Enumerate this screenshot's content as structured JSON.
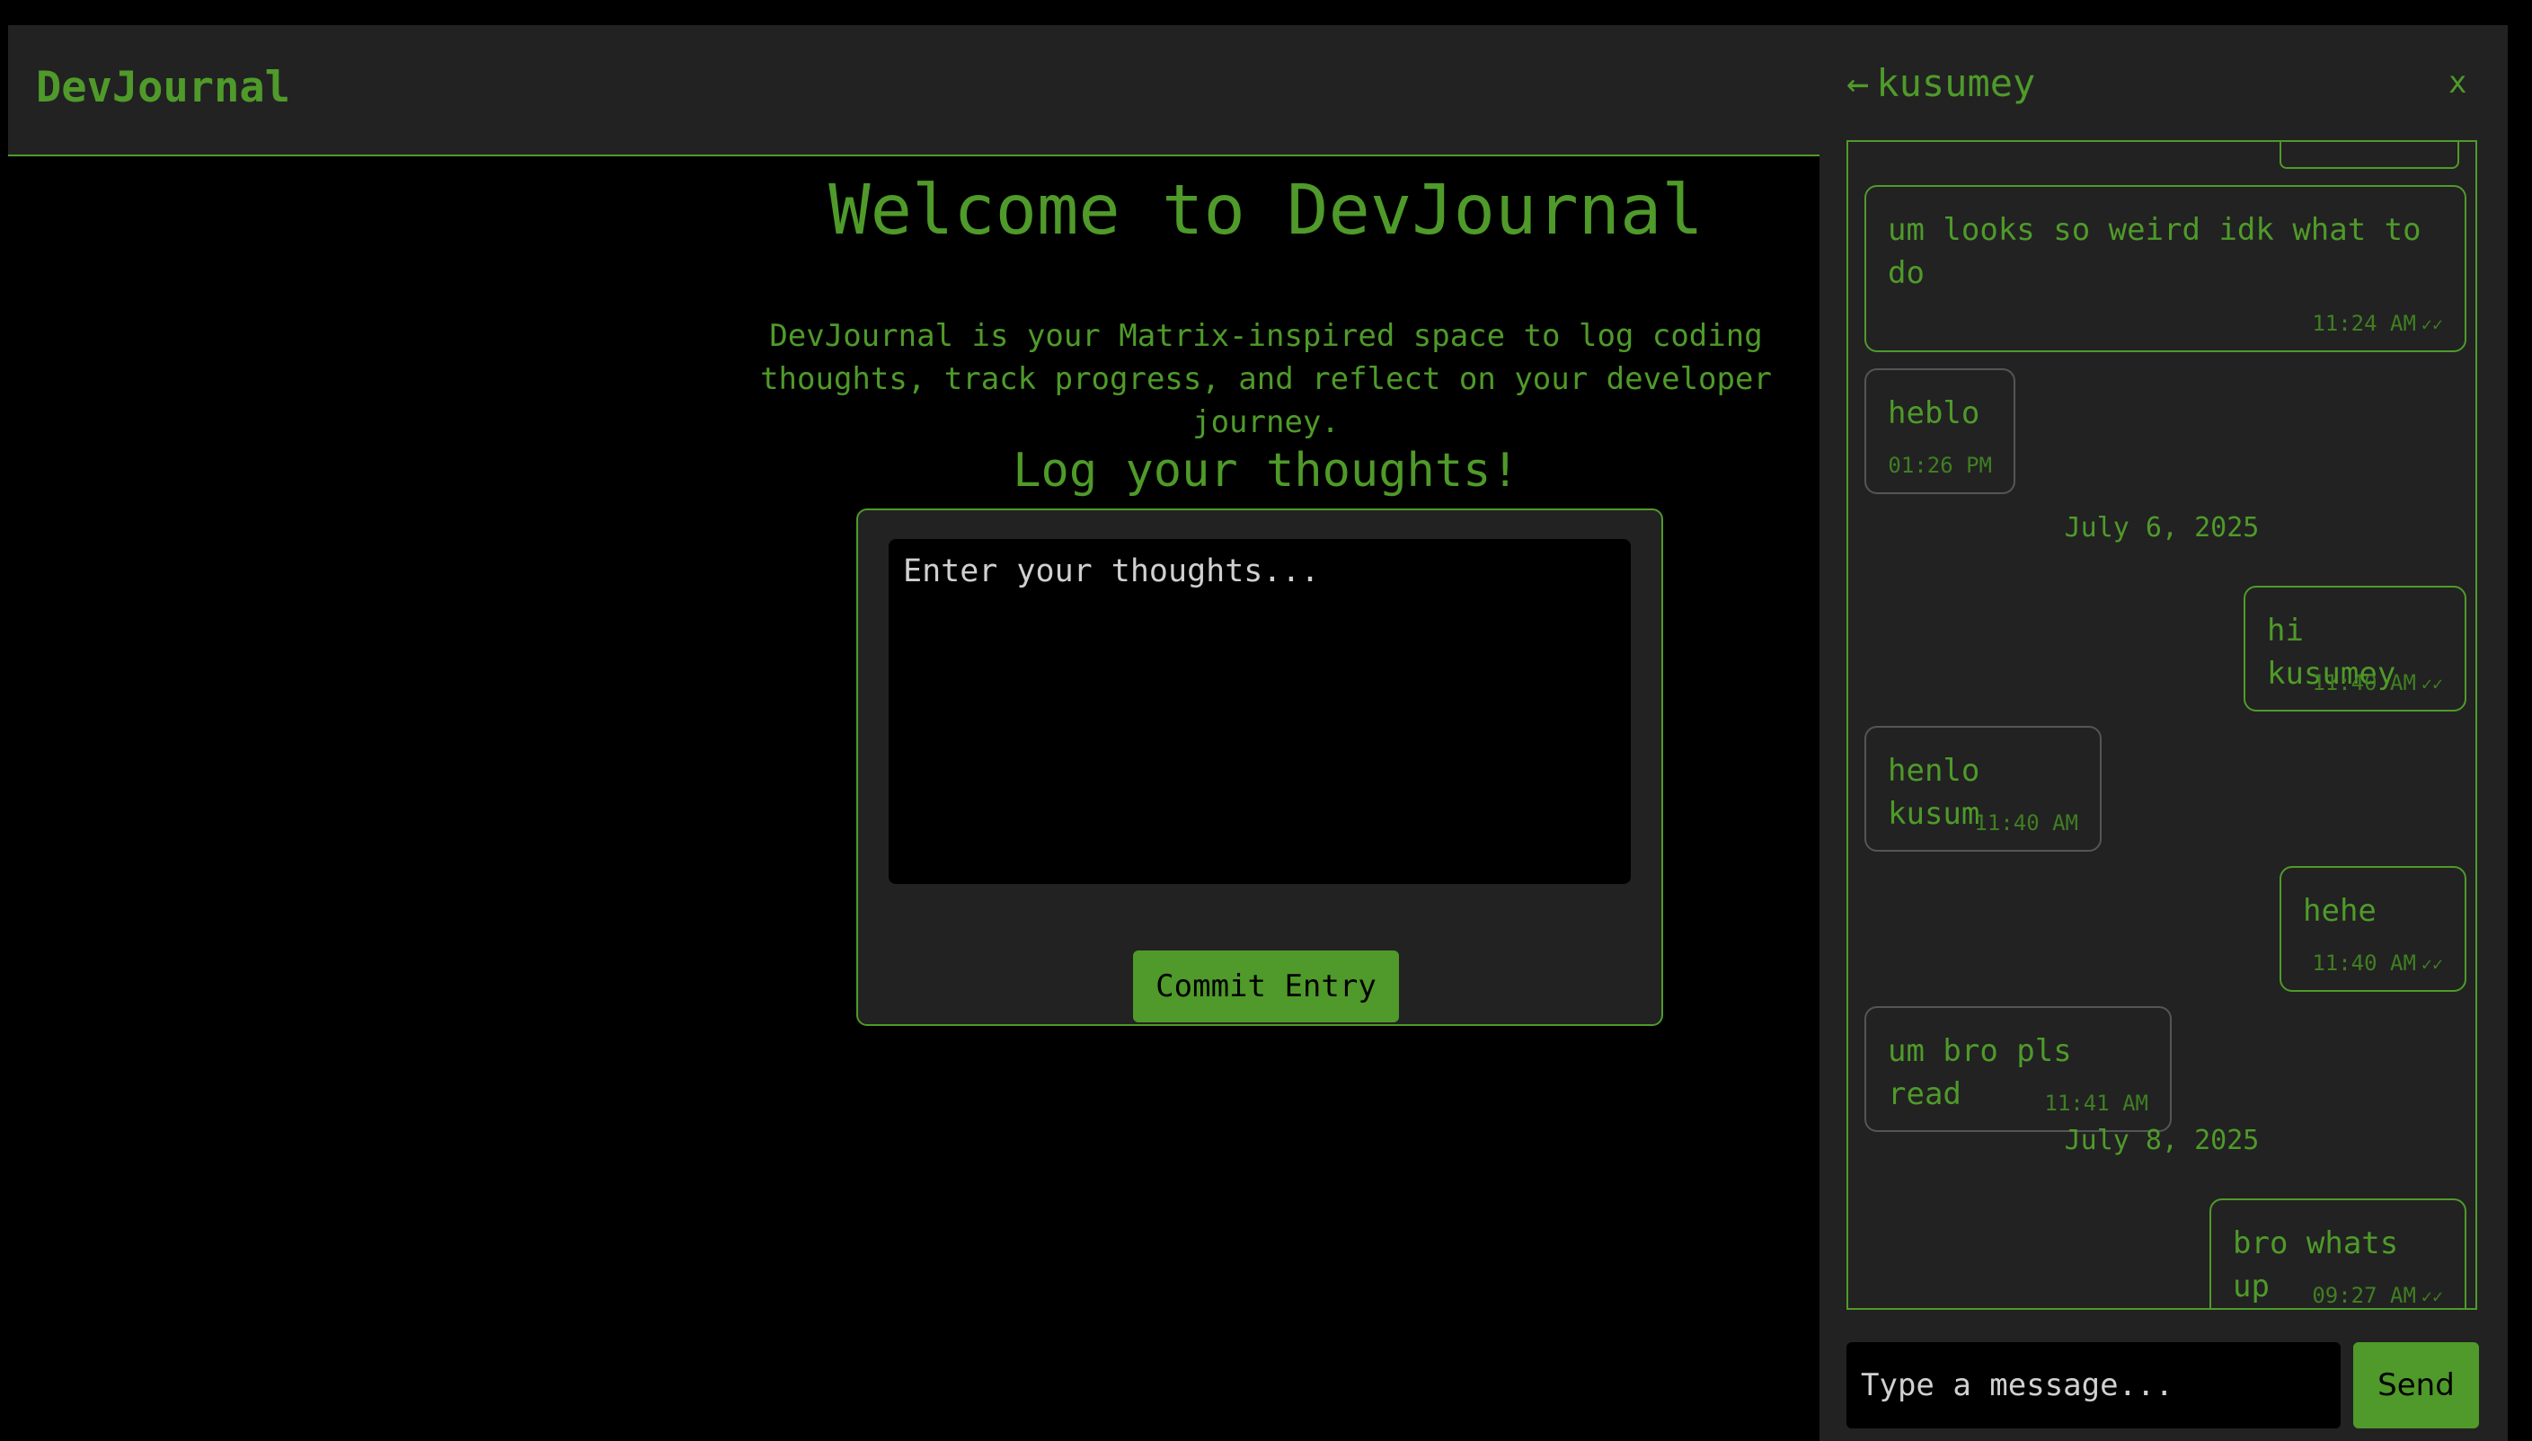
{
  "app": {
    "logo": "DevJournal"
  },
  "main": {
    "title": "Welcome to DevJournal",
    "intro": "DevJournal is your Matrix-inspired space to log coding thoughts, track progress, and reflect on your developer journey.",
    "subtitle": "Log your thoughts!",
    "entry_placeholder": "Enter your thoughts...",
    "commit_label": "Commit Entry"
  },
  "chat": {
    "back_icon": "←",
    "contact": "kusumey",
    "close_label": "x",
    "messages": [
      {
        "text": "um looks so weird idk what to do",
        "time": "11:24 AM",
        "ticks": "✓✓",
        "direction": "sent"
      },
      {
        "text": "heblo",
        "time": "01:26 PM",
        "ticks": "",
        "direction": "received"
      },
      {
        "text": "hi kusumey",
        "time": "11:40 AM",
        "ticks": "✓✓",
        "direction": "sent"
      },
      {
        "text": "henlo kusum",
        "time": "11:40 AM",
        "ticks": "",
        "direction": "received"
      },
      {
        "text": "hehe",
        "time": "11:40 AM",
        "ticks": "✓✓",
        "direction": "sent"
      },
      {
        "text": "um bro pls read",
        "time": "11:41 AM",
        "ticks": "",
        "direction": "received"
      },
      {
        "text": "bro whats up",
        "time": "09:27 AM",
        "ticks": "✓✓",
        "direction": "sent"
      }
    ],
    "date_separators": [
      "July 6, 2025",
      "July 8, 2025"
    ],
    "input_placeholder": "Type a message...",
    "send_label": "Send"
  },
  "colors": {
    "accent": "#4f9a2a",
    "panel_bg": "#222222",
    "page_bg": "#000000",
    "received_border": "#555555"
  },
  "icons": {
    "back": "arrow-left-icon",
    "close": "close-icon",
    "read_receipt": "double-check-icon"
  }
}
